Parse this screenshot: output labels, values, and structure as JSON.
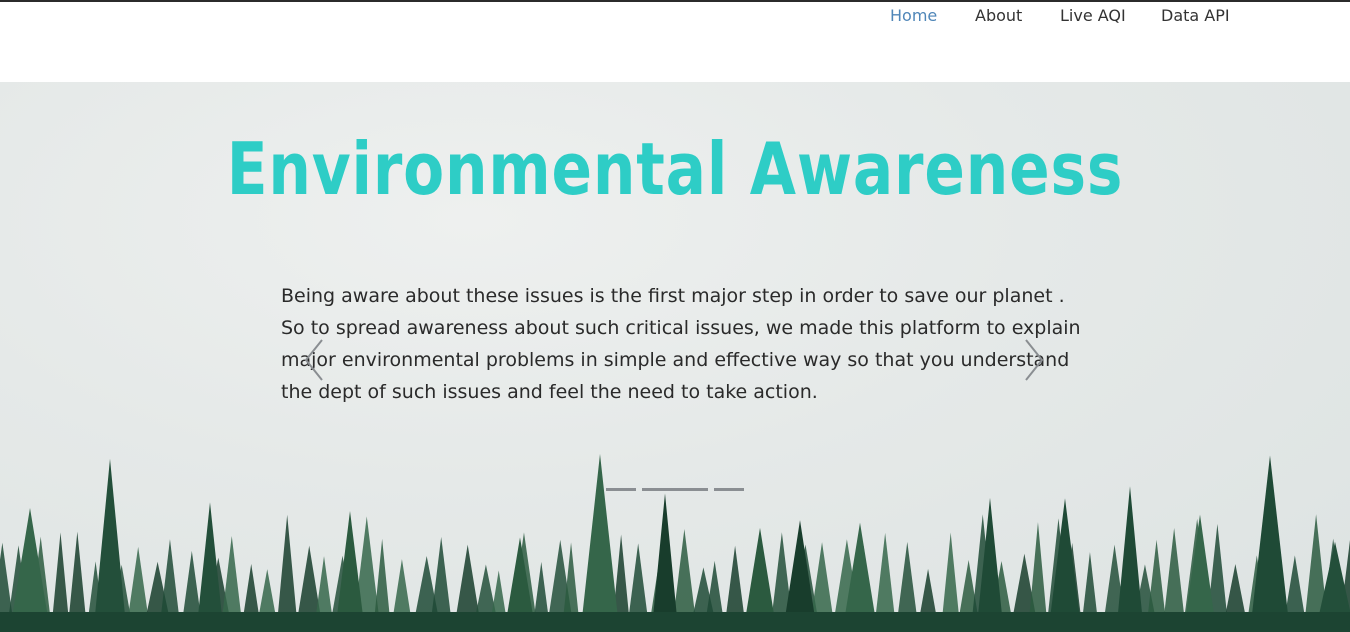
{
  "nav": {
    "items": [
      {
        "label": "Home",
        "active": true
      },
      {
        "label": "About",
        "active": false
      },
      {
        "label": "Live AQI",
        "active": false
      },
      {
        "label": "Data API",
        "active": false
      }
    ]
  },
  "hero": {
    "title": "Environmental Awareness",
    "text": "Being aware about these issues is the first major step in order to save our planet . So to spread awareness about such critical issues, we made this platform to explain major environmental problems in simple and effective way so that you understand the dept of such issues and feel the need to take action.",
    "slide_count": 3,
    "active_slide": 1
  },
  "colors": {
    "accent": "#2ecdc6",
    "nav_active": "#4f86b8",
    "text": "#2a2a2a"
  },
  "icons": {
    "prev": "chevron-left-icon",
    "next": "chevron-right-icon"
  }
}
